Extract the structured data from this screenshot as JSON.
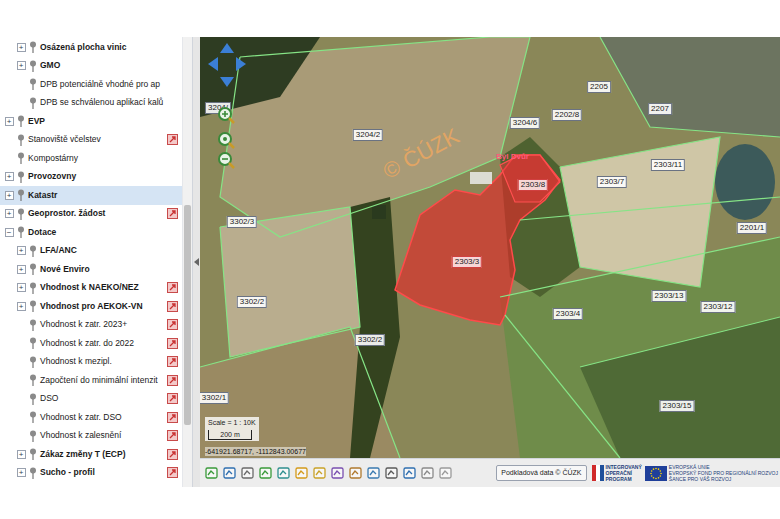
{
  "sidebar": {
    "items": [
      {
        "label": "Osázená plocha vinic",
        "bold": true,
        "expander": "+",
        "level": 1,
        "info": false,
        "selected": false
      },
      {
        "label": "GMO",
        "bold": true,
        "expander": "+",
        "level": 1,
        "info": false,
        "selected": false
      },
      {
        "label": "DPB potenciálně vhodné pro ap",
        "bold": false,
        "expander": "",
        "level": 1,
        "info": false,
        "selected": false
      },
      {
        "label": "DPB se schválenou aplikací kalů",
        "bold": false,
        "expander": "",
        "level": 1,
        "info": false,
        "selected": false
      },
      {
        "label": "EVP",
        "bold": true,
        "expander": "+",
        "level": 0,
        "info": false,
        "selected": false
      },
      {
        "label": "Stanoviště včelstev",
        "bold": false,
        "expander": "",
        "level": 0,
        "info": true,
        "selected": false
      },
      {
        "label": "Kompostárny",
        "bold": false,
        "expander": "",
        "level": 0,
        "info": false,
        "selected": false
      },
      {
        "label": "Provozovny",
        "bold": true,
        "expander": "+",
        "level": 0,
        "info": false,
        "selected": false
      },
      {
        "label": "Katastr",
        "bold": true,
        "expander": "+",
        "level": 0,
        "info": false,
        "selected": true
      },
      {
        "label": "Geoprostor. žádost",
        "bold": true,
        "expander": "+",
        "level": 0,
        "info": true,
        "selected": false
      },
      {
        "label": "Dotace",
        "bold": true,
        "expander": "−",
        "level": 0,
        "info": false,
        "selected": false
      },
      {
        "label": "LFA/ANC",
        "bold": true,
        "expander": "+",
        "level": 1,
        "info": false,
        "selected": false
      },
      {
        "label": "Nové Enviro",
        "bold": true,
        "expander": "+",
        "level": 1,
        "info": false,
        "selected": false
      },
      {
        "label": "Vhodnost k NAEKO/NEZ",
        "bold": true,
        "expander": "+",
        "level": 1,
        "info": true,
        "selected": false
      },
      {
        "label": "Vhodnost pro AEKOK-VN",
        "bold": true,
        "expander": "+",
        "level": 1,
        "info": true,
        "selected": false
      },
      {
        "label": "Vhodnost k zatr. 2023+",
        "bold": false,
        "expander": "",
        "level": 1,
        "info": true,
        "selected": false
      },
      {
        "label": "Vhodnost k zatr. do 2022",
        "bold": false,
        "expander": "",
        "level": 1,
        "info": true,
        "selected": false
      },
      {
        "label": "Vhodnost k mezipl.",
        "bold": false,
        "expander": "",
        "level": 1,
        "info": true,
        "selected": false
      },
      {
        "label": "Započtení do minimální intenzit",
        "bold": false,
        "expander": "",
        "level": 1,
        "info": true,
        "selected": false
      },
      {
        "label": "DSO",
        "bold": false,
        "expander": "",
        "level": 1,
        "info": true,
        "selected": false
      },
      {
        "label": "Vhodnost k zatr. DSO",
        "bold": false,
        "expander": "",
        "level": 1,
        "info": true,
        "selected": false
      },
      {
        "label": "Vhodnost k zalesnění",
        "bold": false,
        "expander": "",
        "level": 1,
        "info": true,
        "selected": false
      },
      {
        "label": "Zákaz změny T (ECP)",
        "bold": true,
        "expander": "+",
        "level": 1,
        "info": true,
        "selected": false
      },
      {
        "label": "Sucho - profil",
        "bold": true,
        "expander": "+",
        "level": 1,
        "info": true,
        "selected": false
      }
    ]
  },
  "map": {
    "watermark": "© ČÚZK",
    "place_label": "Býl Dvůr",
    "parcels": [
      {
        "label": "3204/",
        "selected": false
      },
      {
        "label": "2205",
        "selected": false
      },
      {
        "label": "2207",
        "selected": false
      },
      {
        "label": "3204/6",
        "selected": false
      },
      {
        "label": "2202/8",
        "selected": false
      },
      {
        "label": "3204/2",
        "selected": false
      },
      {
        "label": "2303/11",
        "selected": false
      },
      {
        "label": "2303/7",
        "selected": false
      },
      {
        "label": "2303/8",
        "selected": true
      },
      {
        "label": "2201/1",
        "selected": false
      },
      {
        "label": "3302/3",
        "selected": false
      },
      {
        "label": "2303/3",
        "selected": true
      },
      {
        "label": "2303/13",
        "selected": false
      },
      {
        "label": "2303/4",
        "selected": false
      },
      {
        "label": "2303/12",
        "selected": false
      },
      {
        "label": "3302/2",
        "selected": false
      },
      {
        "label": "3302/2",
        "selected": false
      },
      {
        "label": "2303/15",
        "selected": false
      },
      {
        "label": "3302/1",
        "selected": false
      }
    ]
  },
  "scale": {
    "text": "Scale = 1 : 10K",
    "bar": "200 m"
  },
  "coordinates": "-641921.68717, -1112843.00677",
  "toolbar": {
    "attribution": "Podkladová data © ČÚZK"
  },
  "logos": {
    "iop": [
      "INTEGROVANÝ",
      "OPERAČNÍ",
      "PROGRAM"
    ],
    "eu": [
      "EVROPSKÁ UNIE",
      "EVROPSKÝ FOND PRO REGIONÁLNÍ ROZVOJ",
      "ŠANCE PRO VÁŠ ROZVOJ"
    ]
  }
}
